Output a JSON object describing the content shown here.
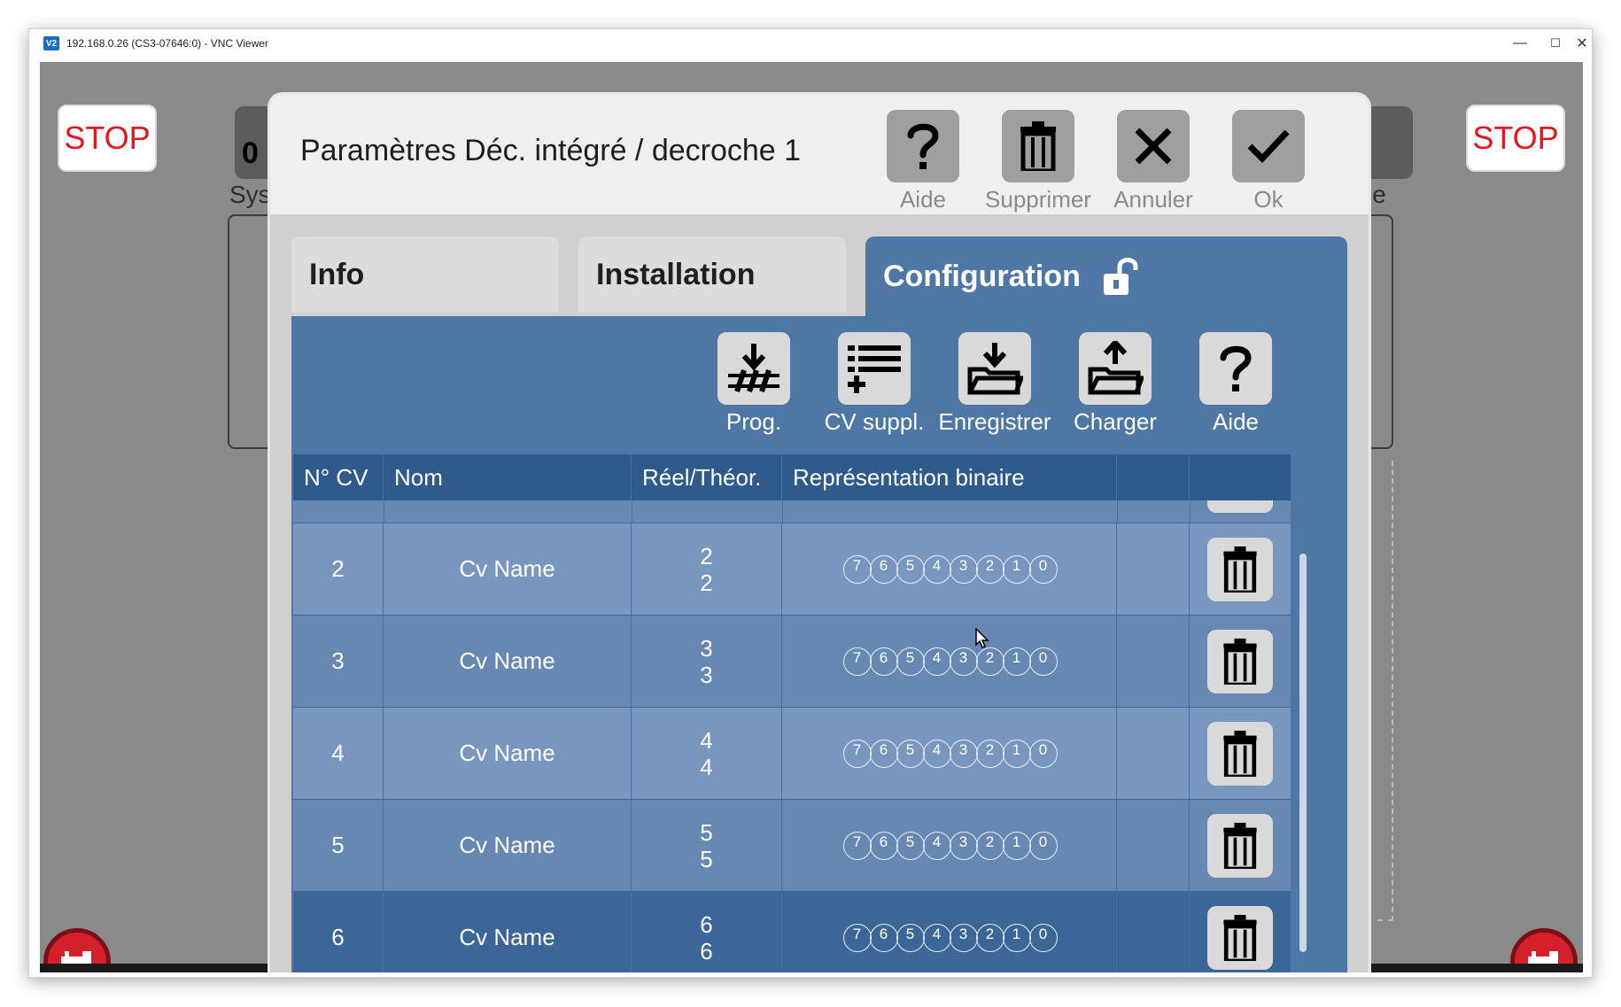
{
  "window": {
    "icon_text": "V2",
    "title": "192.168.0.26 (CS3-07646:0) - VNC Viewer",
    "minimize": "—",
    "maximize": "☐",
    "close": "✕"
  },
  "background": {
    "stop_label": "STOP",
    "tile_digit": "0",
    "label_left": "Sys",
    "label_right": "le"
  },
  "dialog": {
    "title": "Paramètres Déc. intégré / decroche 1",
    "header_buttons": [
      {
        "label": "Aide",
        "icon": "question-icon"
      },
      {
        "label": "Supprimer",
        "icon": "trash-icon"
      },
      {
        "label": "Annuler",
        "icon": "close-icon"
      },
      {
        "label": "Ok",
        "icon": "check-icon"
      }
    ],
    "tabs": [
      {
        "label": "Info",
        "active": false
      },
      {
        "label": "Installation",
        "active": false
      },
      {
        "label": "Configuration",
        "active": true,
        "icon": "unlock-icon"
      }
    ],
    "toolbar": [
      {
        "label": "Prog.",
        "icon": "program-track-icon"
      },
      {
        "label": "CV suppl.",
        "icon": "add-list-icon"
      },
      {
        "label": "Enregistrer",
        "icon": "save-folder-icon"
      },
      {
        "label": "Charger",
        "icon": "load-folder-icon"
      },
      {
        "label": "Aide",
        "icon": "question-icon"
      }
    ]
  },
  "table": {
    "headers": [
      "N° CV",
      "Nom",
      "Réel/Théor.",
      "Représentation binaire",
      "",
      ""
    ],
    "bit_labels": [
      "7",
      "6",
      "5",
      "4",
      "3",
      "2",
      "1",
      "0"
    ],
    "rows": [
      {
        "cv": "2",
        "name": "Cv Name",
        "real": "2",
        "theor": "2"
      },
      {
        "cv": "3",
        "name": "Cv Name",
        "real": "3",
        "theor": "3"
      },
      {
        "cv": "4",
        "name": "Cv Name",
        "real": "4",
        "theor": "4"
      },
      {
        "cv": "5",
        "name": "Cv Name",
        "real": "5",
        "theor": "5"
      },
      {
        "cv": "6",
        "name": "Cv Name",
        "real": "6",
        "theor": "6"
      }
    ]
  },
  "colors": {
    "accent_blue": "#4f77a6",
    "header_blue": "#2e5a8c",
    "stop_red": "#e2171f"
  }
}
